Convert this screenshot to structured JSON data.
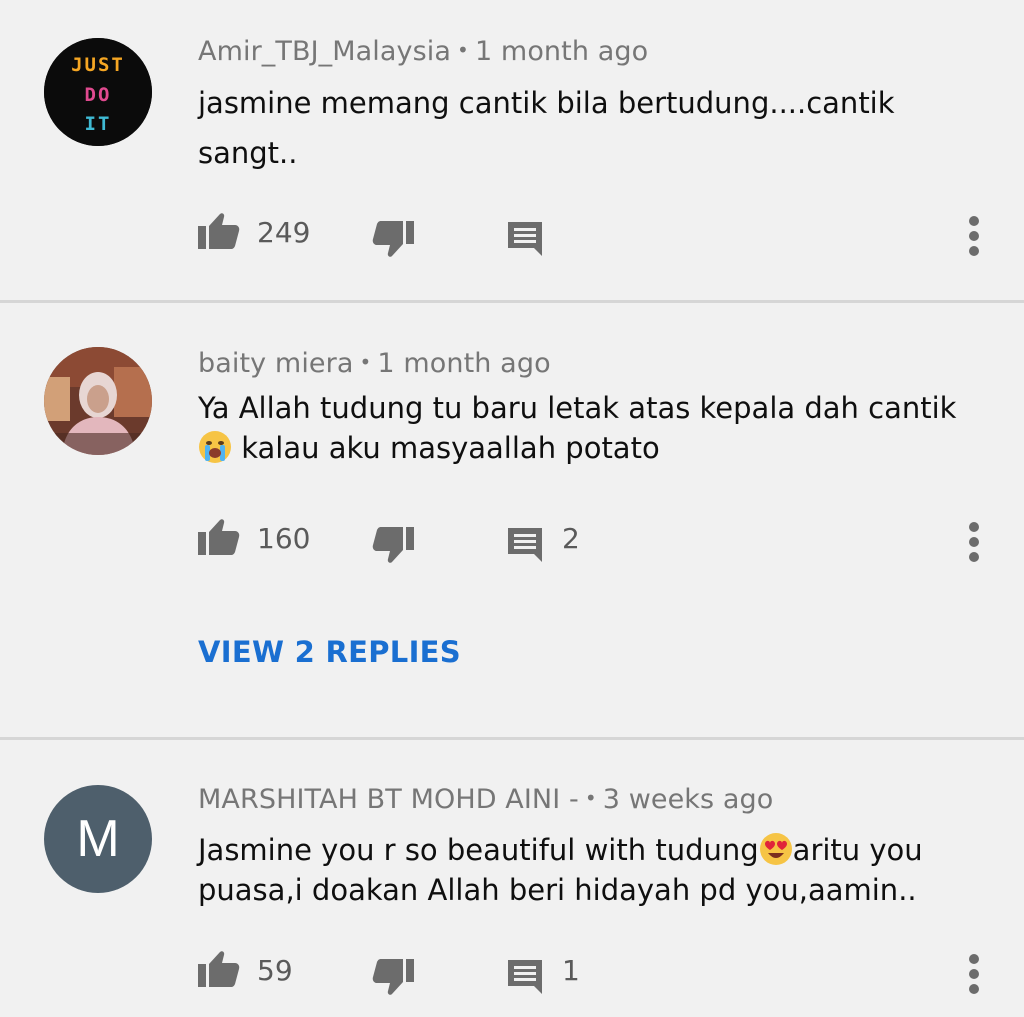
{
  "comments": [
    {
      "author": "Amir_TBJ_Malaysia",
      "separator": "•",
      "time": "1 month ago",
      "text_line1": "jasmine memang cantik bila bertudung....cantik",
      "text_line2": "sangt..",
      "avatar_text": [
        "JUST",
        "DO",
        "IT"
      ],
      "likes": "249",
      "replies": ""
    },
    {
      "author": "baity miera",
      "separator": "•",
      "time": "1 month ago",
      "text_line1": "Ya Allah tudung tu baru letak atas kepala dah cantik",
      "text_line2": "kalau aku masyaallah potato",
      "emoji_line2": "crying-face",
      "likes": "160",
      "replies": "2",
      "view_replies": "VIEW 2 REPLIES"
    },
    {
      "author": "MARSHITAH BT MOHD AINI -",
      "separator": "•",
      "time": "3 weeks ago",
      "text_line1_a": "Jasmine you r so beautiful with tudung",
      "text_line1_b": "aritu you",
      "emoji_line1": "heart-eyes-face",
      "text_line2": "puasa,i doakan Allah beri hidayah pd you,aamin..",
      "avatar_letter": "M",
      "avatar_color": "#4e5f6c",
      "likes": "59",
      "replies": "1"
    }
  ],
  "colors": {
    "background": "#f1f1f1",
    "link": "#1a6fd1",
    "meta": "#767676",
    "icon": "#6c6c6c"
  }
}
